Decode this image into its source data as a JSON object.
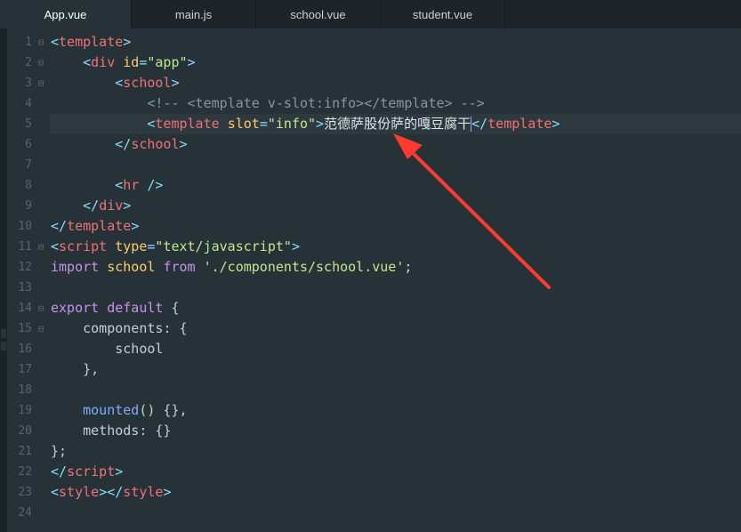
{
  "tabs": [
    {
      "label": "App.vue",
      "active": true
    },
    {
      "label": "main.js",
      "active": false
    },
    {
      "label": "school.vue",
      "active": false
    },
    {
      "label": "student.vue",
      "active": false
    }
  ],
  "current_line": 5,
  "lines": [
    {
      "num": "1",
      "fold": "⊟",
      "tokens": [
        {
          "c": "pt",
          "t": "<"
        },
        {
          "c": "tg",
          "t": "template"
        },
        {
          "c": "pt",
          "t": ">"
        }
      ]
    },
    {
      "num": "2",
      "fold": "⊟",
      "tokens": [
        {
          "c": "tx",
          "t": "    "
        },
        {
          "c": "pt",
          "t": "<"
        },
        {
          "c": "tg",
          "t": "div"
        },
        {
          "c": "tx",
          "t": " "
        },
        {
          "c": "at",
          "t": "id"
        },
        {
          "c": "pt",
          "t": "="
        },
        {
          "c": "st",
          "t": "\"app\""
        },
        {
          "c": "pt",
          "t": ">"
        }
      ]
    },
    {
      "num": "3",
      "fold": "⊟",
      "tokens": [
        {
          "c": "tx",
          "t": "        "
        },
        {
          "c": "pt",
          "t": "<"
        },
        {
          "c": "tg",
          "t": "school"
        },
        {
          "c": "pt",
          "t": ">"
        }
      ]
    },
    {
      "num": "4",
      "fold": "",
      "tokens": [
        {
          "c": "tx",
          "t": "            "
        },
        {
          "c": "cm",
          "t": "<!-- <template v-slot:info></template> -->"
        }
      ]
    },
    {
      "num": "5",
      "fold": "",
      "tokens": [
        {
          "c": "tx",
          "t": "            "
        },
        {
          "c": "pt",
          "t": "<"
        },
        {
          "c": "tg",
          "t": "template"
        },
        {
          "c": "tx",
          "t": " "
        },
        {
          "c": "at",
          "t": "slot"
        },
        {
          "c": "pt",
          "t": "="
        },
        {
          "c": "st",
          "t": "\"info\""
        },
        {
          "c": "pt",
          "t": ">"
        },
        {
          "c": "cn",
          "t": "范德萨股份萨的嘎豆腐干"
        },
        {
          "c": "caret",
          "t": ""
        },
        {
          "c": "pt",
          "t": "</"
        },
        {
          "c": "tg",
          "t": "template"
        },
        {
          "c": "pt",
          "t": ">"
        }
      ]
    },
    {
      "num": "6",
      "fold": "",
      "tokens": [
        {
          "c": "tx",
          "t": "        "
        },
        {
          "c": "pt",
          "t": "</"
        },
        {
          "c": "tg",
          "t": "school"
        },
        {
          "c": "pt",
          "t": ">"
        }
      ]
    },
    {
      "num": "7",
      "fold": "",
      "tokens": []
    },
    {
      "num": "8",
      "fold": "",
      "tokens": [
        {
          "c": "tx",
          "t": "        "
        },
        {
          "c": "pt",
          "t": "<"
        },
        {
          "c": "tg",
          "t": "hr"
        },
        {
          "c": "tx",
          "t": " "
        },
        {
          "c": "pt",
          "t": "/>"
        }
      ]
    },
    {
      "num": "9",
      "fold": "",
      "tokens": [
        {
          "c": "tx",
          "t": "    "
        },
        {
          "c": "pt",
          "t": "</"
        },
        {
          "c": "tg",
          "t": "div"
        },
        {
          "c": "pt",
          "t": ">"
        }
      ]
    },
    {
      "num": "10",
      "fold": "",
      "tokens": [
        {
          "c": "pt",
          "t": "</"
        },
        {
          "c": "tg",
          "t": "template"
        },
        {
          "c": "pt",
          "t": ">"
        }
      ]
    },
    {
      "num": "11",
      "fold": "⊟",
      "tokens": [
        {
          "c": "pt",
          "t": "<"
        },
        {
          "c": "tg",
          "t": "script"
        },
        {
          "c": "tx",
          "t": " "
        },
        {
          "c": "at",
          "t": "type"
        },
        {
          "c": "pt",
          "t": "="
        },
        {
          "c": "st",
          "t": "\"text/javascript\""
        },
        {
          "c": "pt",
          "t": ">"
        }
      ]
    },
    {
      "num": "12",
      "fold": "",
      "tokens": [
        {
          "c": "kw",
          "t": "import"
        },
        {
          "c": "tx",
          "t": " "
        },
        {
          "c": "at",
          "t": "school"
        },
        {
          "c": "tx",
          "t": " "
        },
        {
          "c": "kw",
          "t": "from"
        },
        {
          "c": "tx",
          "t": " "
        },
        {
          "c": "st",
          "t": "'./components/school.vue'"
        },
        {
          "c": "tx",
          "t": ";"
        }
      ]
    },
    {
      "num": "13",
      "fold": "",
      "tokens": []
    },
    {
      "num": "14",
      "fold": "⊟",
      "tokens": [
        {
          "c": "kw",
          "t": "export"
        },
        {
          "c": "tx",
          "t": " "
        },
        {
          "c": "kw",
          "t": "default"
        },
        {
          "c": "tx",
          "t": " {"
        }
      ]
    },
    {
      "num": "15",
      "fold": "⊟",
      "tokens": [
        {
          "c": "tx",
          "t": "    components: {"
        }
      ]
    },
    {
      "num": "16",
      "fold": "",
      "tokens": [
        {
          "c": "tx",
          "t": "        school"
        }
      ]
    },
    {
      "num": "17",
      "fold": "",
      "tokens": [
        {
          "c": "tx",
          "t": "    },"
        }
      ]
    },
    {
      "num": "18",
      "fold": "",
      "tokens": []
    },
    {
      "num": "19",
      "fold": "",
      "tokens": [
        {
          "c": "tx",
          "t": "    "
        },
        {
          "c": "fn",
          "t": "mounted"
        },
        {
          "c": "tx",
          "t": "() {},"
        }
      ]
    },
    {
      "num": "20",
      "fold": "",
      "tokens": [
        {
          "c": "tx",
          "t": "    methods: {}"
        }
      ]
    },
    {
      "num": "21",
      "fold": "",
      "tokens": [
        {
          "c": "tx",
          "t": "};"
        }
      ]
    },
    {
      "num": "22",
      "fold": "",
      "tokens": [
        {
          "c": "pt",
          "t": "</"
        },
        {
          "c": "tg",
          "t": "script"
        },
        {
          "c": "pt",
          "t": ">"
        }
      ]
    },
    {
      "num": "23",
      "fold": "",
      "tokens": [
        {
          "c": "pt",
          "t": "<"
        },
        {
          "c": "tg",
          "t": "style"
        },
        {
          "c": "pt",
          "t": "></"
        },
        {
          "c": "tg",
          "t": "style"
        },
        {
          "c": "pt",
          "t": ">"
        }
      ]
    },
    {
      "num": "24",
      "fold": "",
      "tokens": []
    }
  ],
  "colors": {
    "background": "#263238",
    "tag": "#f07178",
    "punctuation": "#89ddff",
    "attribute": "#ffcb6b",
    "string": "#c3e88d",
    "keyword": "#c792ea",
    "function": "#82aaff",
    "comment": "#8796a0",
    "annotation_arrow": "#ff3b30"
  }
}
